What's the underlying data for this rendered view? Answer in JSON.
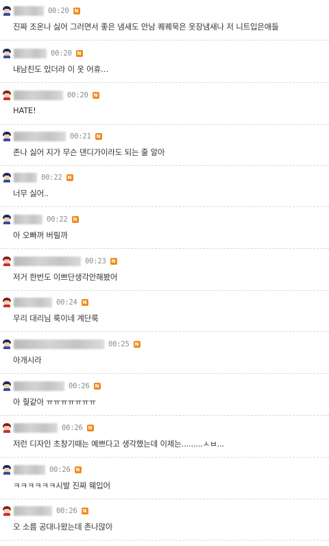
{
  "new_badge_label": "N",
  "colors": {
    "badge": "#f08a1c",
    "text": "#333333",
    "time": "#8a8a8a",
    "divider": "#d6d6d6"
  },
  "comments": [
    {
      "time": "00:20",
      "text": "진짜 조온나 싫어 그러면서 좋은 냄새도 안남 퀘퀘묵은 옷장냄새나 저 니트입은애들",
      "avatar": "blue"
    },
    {
      "time": "00:20",
      "text": "내남친도 있더라 이 옷 어휴…",
      "avatar": "blue"
    },
    {
      "time": "00:20",
      "text": "HATE!",
      "avatar": "red"
    },
    {
      "time": "00:21",
      "text": "존나 싫어 지가 무슨 댄디가이라도 되는 줄 알아",
      "avatar": "blue"
    },
    {
      "time": "00:22",
      "text": "너무 싫어..",
      "avatar": "blue"
    },
    {
      "time": "00:22",
      "text": "아 오빠꺼 버릴까",
      "avatar": "blue"
    },
    {
      "time": "00:23",
      "text": "저거 한번도 이쁘단생각안해봤어",
      "avatar": "red"
    },
    {
      "time": "00:24",
      "text": "우리 대리님 룩이네 계단룩",
      "avatar": "red"
    },
    {
      "time": "00:25",
      "text": "아개시라",
      "avatar": "blue"
    },
    {
      "time": "00:26",
      "text": "아 줮같아 ㅠㅠㅠㅠㅠㅠㅠ",
      "avatar": "blue"
    },
    {
      "time": "00:26",
      "text": "저런 디자인 초창기때는 예쁘다고 생각했는데 이제는.........ㅅㅂ...",
      "avatar": "red"
    },
    {
      "time": "00:26",
      "text": "ㅋㅋㅋㅋㅋㅋ시발 진짜 웨입어",
      "avatar": "blue"
    },
    {
      "time": "00:26",
      "text": "오 소름 공대나왔는데 존나많아",
      "avatar": "red"
    }
  ]
}
